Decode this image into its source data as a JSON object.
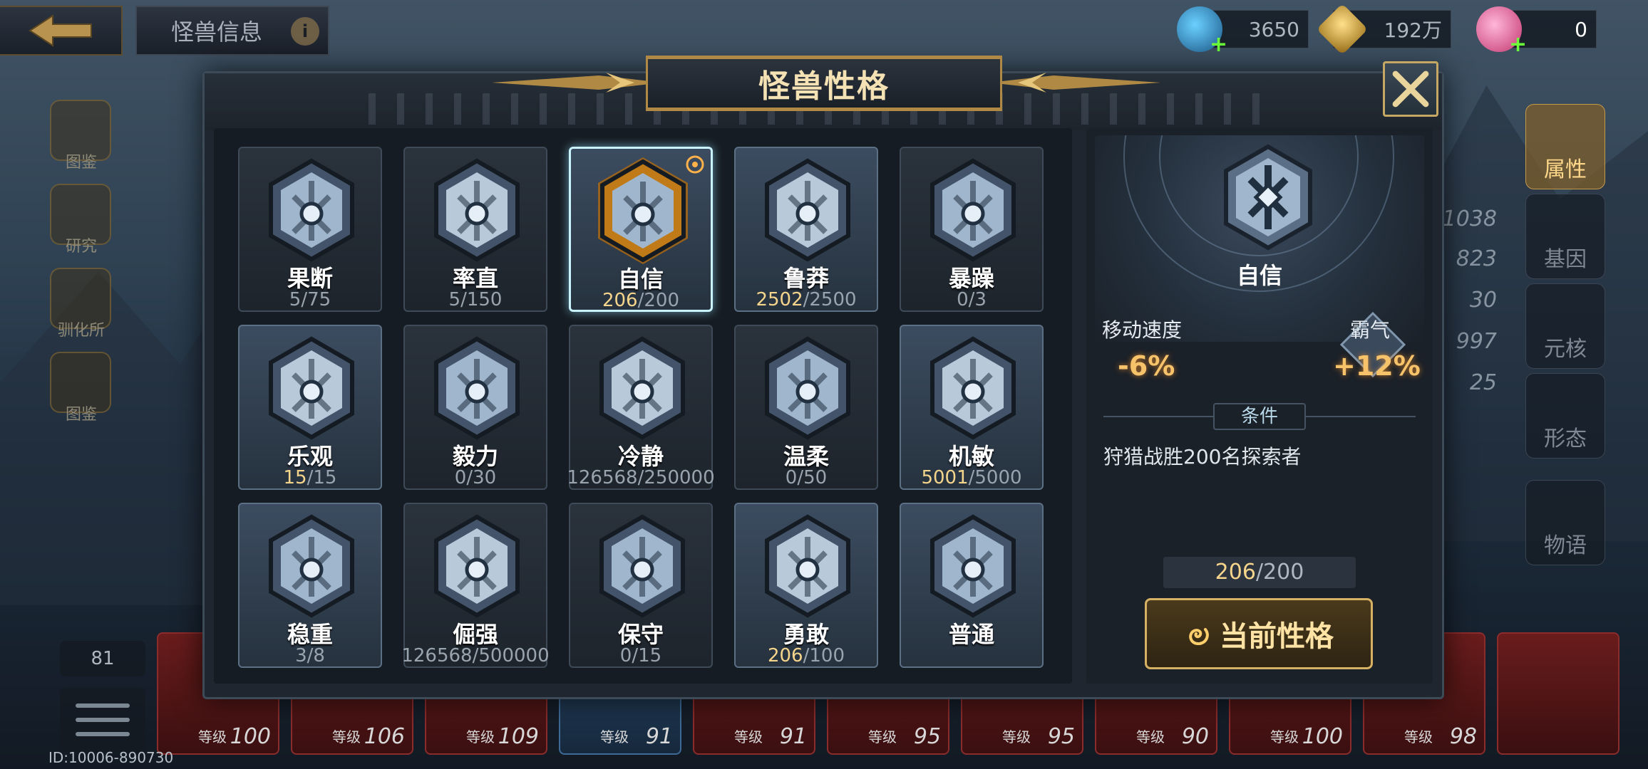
{
  "topbar": {
    "back_icon": "back-arrow-icon",
    "title": "怪兽信息",
    "info_icon": "info-icon",
    "info_glyph": "i"
  },
  "resources": [
    {
      "name": "crystal",
      "value": "3650",
      "icon": "crystal-icon"
    },
    {
      "name": "gold",
      "value": "192万",
      "icon": "gold-icon"
    },
    {
      "name": "charm",
      "value": "0",
      "icon": "pink-swirl-icon"
    }
  ],
  "side_left": {
    "labels": [
      "图鉴",
      "研究",
      "驯化所",
      "图鉴"
    ]
  },
  "side_right": {
    "tabs": [
      "属性",
      "基因",
      "元核",
      "形态",
      "物语"
    ],
    "stats": [
      "1038",
      "823",
      "30",
      "997",
      "25"
    ]
  },
  "bottom": {
    "count": "81",
    "id_text": "ID:10006-890730",
    "level_label": "等级",
    "cards": [
      "100",
      "106",
      "109",
      "91",
      "91",
      "95",
      "95",
      "90",
      "100",
      "98",
      ""
    ]
  },
  "modal": {
    "title": "怪兽性格",
    "close_icon": "close-x-icon",
    "traits": [
      {
        "name": "果断",
        "current": "5",
        "total": "75",
        "done": false,
        "emblem": "diamond-shield-emblem-icon",
        "lit": false,
        "selected": false
      },
      {
        "name": "率直",
        "current": "5",
        "total": "150",
        "done": false,
        "emblem": "drop-swirl-emblem-icon",
        "lit": false,
        "selected": false
      },
      {
        "name": "自信",
        "current": "206",
        "total": "200",
        "done": true,
        "emblem": "cross-lattice-emblem-icon",
        "lit": true,
        "selected": true
      },
      {
        "name": "鲁莽",
        "current": "2502",
        "total": "2500",
        "done": true,
        "emblem": "claw-emblem-icon",
        "lit": true,
        "selected": false
      },
      {
        "name": "暴躁",
        "current": "0",
        "total": "3",
        "done": false,
        "emblem": "burst-star-emblem-icon",
        "lit": false,
        "selected": false
      },
      {
        "name": "乐观",
        "current": "15",
        "total": "15",
        "done": true,
        "emblem": "sun-face-emblem-icon",
        "lit": true,
        "selected": false
      },
      {
        "name": "毅力",
        "current": "0",
        "total": "30",
        "done": false,
        "emblem": "lotus-emblem-icon",
        "lit": false,
        "selected": false
      },
      {
        "name": "冷静",
        "current": "126568",
        "total": "250000",
        "done": false,
        "emblem": "water-emblem-icon",
        "lit": false,
        "selected": false
      },
      {
        "name": "温柔",
        "current": "0",
        "total": "50",
        "done": false,
        "emblem": "spiral-pillar-emblem-icon",
        "lit": false,
        "selected": false
      },
      {
        "name": "机敏",
        "current": "5001",
        "total": "5000",
        "done": true,
        "emblem": "hex-star-emblem-icon",
        "lit": true,
        "selected": false
      },
      {
        "name": "稳重",
        "current": "3",
        "total": "8",
        "done": false,
        "emblem": "arrow-emblem-icon",
        "lit": true,
        "selected": false
      },
      {
        "name": "倔强",
        "current": "126568",
        "total": "500000",
        "done": false,
        "emblem": "horns-emblem-icon",
        "lit": false,
        "selected": false
      },
      {
        "name": "保守",
        "current": "0",
        "total": "15",
        "done": false,
        "emblem": "helmet-emblem-icon",
        "lit": false,
        "selected": false
      },
      {
        "name": "勇敢",
        "current": "206",
        "total": "100",
        "done": true,
        "emblem": "up-arrow-emblem-icon",
        "lit": true,
        "selected": false
      },
      {
        "name": "普通",
        "current": "",
        "total": "",
        "done": false,
        "emblem": "spiral-emblem-icon",
        "lit": true,
        "selected": false
      }
    ],
    "detail": {
      "name": "自信",
      "emblem": "cross-lattice-emblem-icon",
      "stat_left_label": "移动速度",
      "stat_left_value": "-6%",
      "stat_right_label": "霸气",
      "stat_right_value": "+12%",
      "condition_tag": "条件",
      "condition_text": "狩猎战胜200名探索者",
      "progress_current": "206",
      "progress_total": "200",
      "button_label": "当前性格",
      "button_icon": "swirl-icon"
    }
  },
  "colors": {
    "gold": "#d6b063",
    "done_progress": "#f5d48c",
    "stat_orange": "#f7c36a",
    "selected_border": "#c9f3ff"
  }
}
